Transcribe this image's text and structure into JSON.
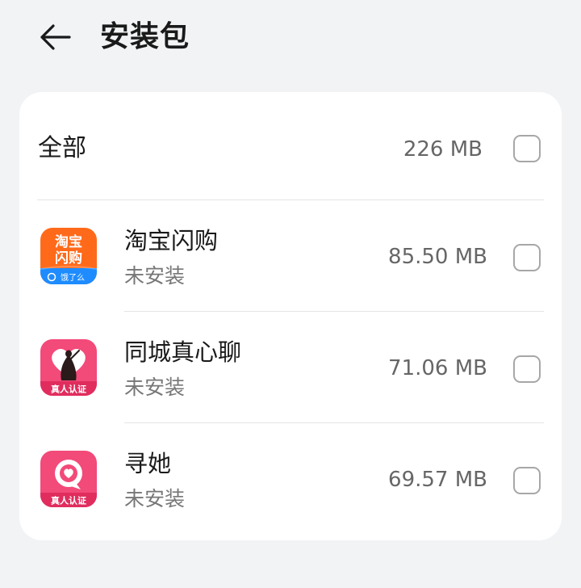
{
  "header": {
    "back_icon": "arrow-left-icon",
    "title": "安装包"
  },
  "summary": {
    "label": "全部",
    "size": "226 MB",
    "checked": false
  },
  "apps": [
    {
      "name": "淘宝闪购",
      "status": "未安装",
      "size": "85.50 MB",
      "icon": "taobao-shangou-app-icon",
      "icon_text_top": "淘宝",
      "icon_text_mid": "闪购",
      "icon_text_bottom": "饿了么",
      "checked": false
    },
    {
      "name": "同城真心聊",
      "status": "未安装",
      "size": "71.06 MB",
      "icon": "tongcheng-zhenxinliao-app-icon",
      "icon_text_bottom": "真人认证",
      "checked": false
    },
    {
      "name": "寻她",
      "status": "未安装",
      "size": "69.57 MB",
      "icon": "xunta-app-icon",
      "icon_text_bottom": "真人认证",
      "checked": false
    }
  ],
  "colors": {
    "background": "#f1f3f5",
    "card": "#ffffff",
    "checkbox_border": "#a7a7a7",
    "taobao_orange": "#ff6a1a",
    "taobao_blue": "#1e8cff",
    "pink": "#f24a79",
    "dark_pink": "#e02d5e"
  }
}
